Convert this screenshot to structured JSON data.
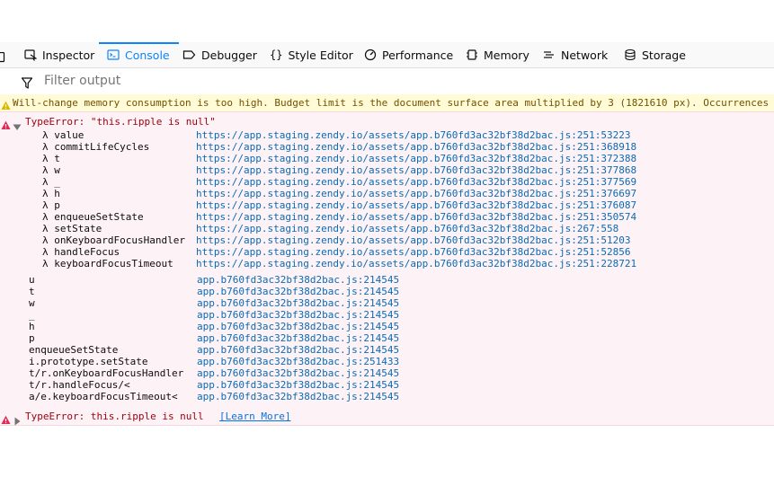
{
  "toolbar": {
    "tabs": [
      {
        "label": "Inspector",
        "icon": "inspector-icon",
        "selected": false
      },
      {
        "label": "Console",
        "icon": "console-icon",
        "selected": true
      },
      {
        "label": "Debugger",
        "icon": "debugger-icon",
        "selected": false
      },
      {
        "label": "Style Editor",
        "icon": "style-editor-icon",
        "selected": false
      },
      {
        "label": "Performance",
        "icon": "performance-icon",
        "selected": false
      },
      {
        "label": "Memory",
        "icon": "memory-icon",
        "selected": false
      },
      {
        "label": "Network",
        "icon": "network-icon",
        "selected": false
      },
      {
        "label": "Storage",
        "icon": "storage-icon",
        "selected": false
      }
    ]
  },
  "filter": {
    "placeholder": "Filter output"
  },
  "console": {
    "warning": "Will-change memory consumption is too high. Budget limit is the document surface area multiplied by 3 (1821610 px). Occurrences of will-change over the budget will be ignored.",
    "error1": {
      "message": "TypeError: \"this.ripple is null\"",
      "stack": [
        {
          "fn": "λ value",
          "loc": "https://app.staging.zendy.io/assets/app.b760fd3ac32bf38d2bac.js:251:53223"
        },
        {
          "fn": "λ commitLifeCycles",
          "loc": "https://app.staging.zendy.io/assets/app.b760fd3ac32bf38d2bac.js:251:368918"
        },
        {
          "fn": "λ t",
          "loc": "https://app.staging.zendy.io/assets/app.b760fd3ac32bf38d2bac.js:251:372388"
        },
        {
          "fn": "λ w",
          "loc": "https://app.staging.zendy.io/assets/app.b760fd3ac32bf38d2bac.js:251:377868"
        },
        {
          "fn": "λ _",
          "loc": "https://app.staging.zendy.io/assets/app.b760fd3ac32bf38d2bac.js:251:377569"
        },
        {
          "fn": "λ h",
          "loc": "https://app.staging.zendy.io/assets/app.b760fd3ac32bf38d2bac.js:251:376697"
        },
        {
          "fn": "λ p",
          "loc": "https://app.staging.zendy.io/assets/app.b760fd3ac32bf38d2bac.js:251:376087"
        },
        {
          "fn": "λ enqueueSetState",
          "loc": "https://app.staging.zendy.io/assets/app.b760fd3ac32bf38d2bac.js:251:350574"
        },
        {
          "fn": "λ setState",
          "loc": "https://app.staging.zendy.io/assets/app.b760fd3ac32bf38d2bac.js:267:558"
        },
        {
          "fn": "λ onKeyboardFocusHandler",
          "loc": "https://app.staging.zendy.io/assets/app.b760fd3ac32bf38d2bac.js:251:51203"
        },
        {
          "fn": "λ handleFocus",
          "loc": "https://app.staging.zendy.io/assets/app.b760fd3ac32bf38d2bac.js:251:52856"
        },
        {
          "fn": "λ keyboardFocusTimeout",
          "loc": "https://app.staging.zendy.io/assets/app.b760fd3ac32bf38d2bac.js:251:228721"
        }
      ],
      "raw_stack": [
        {
          "fn": "u",
          "loc": "app.b760fd3ac32bf38d2bac.js:214545"
        },
        {
          "fn": "t",
          "loc": "app.b760fd3ac32bf38d2bac.js:214545"
        },
        {
          "fn": "w",
          "loc": "app.b760fd3ac32bf38d2bac.js:214545"
        },
        {
          "fn": "_",
          "loc": "app.b760fd3ac32bf38d2bac.js:214545"
        },
        {
          "fn": "h",
          "loc": "app.b760fd3ac32bf38d2bac.js:214545"
        },
        {
          "fn": "p",
          "loc": "app.b760fd3ac32bf38d2bac.js:214545"
        },
        {
          "fn": "enqueueSetState",
          "loc": "app.b760fd3ac32bf38d2bac.js:214545"
        },
        {
          "fn": "i.prototype.setState",
          "loc": "app.b760fd3ac32bf38d2bac.js:251433"
        },
        {
          "fn": "t/r.onKeyboardFocusHandler",
          "loc": "app.b760fd3ac32bf38d2bac.js:214545"
        },
        {
          "fn": "t/r.handleFocus/<",
          "loc": "app.b760fd3ac32bf38d2bac.js:214545"
        },
        {
          "fn": "a/e.keyboardFocusTimeout<",
          "loc": "app.b760fd3ac32bf38d2bac.js:214545"
        }
      ]
    },
    "error2": {
      "message": "TypeError: this.ripple is null",
      "learn_more": "[Learn More]"
    }
  },
  "colors": {
    "accent": "#0a84ff",
    "error_bg": "#fdf2f5",
    "error_text": "#a4000f",
    "warning_bg": "#fffbd6",
    "warning_text": "#715100",
    "link": "#0a6bb5"
  }
}
